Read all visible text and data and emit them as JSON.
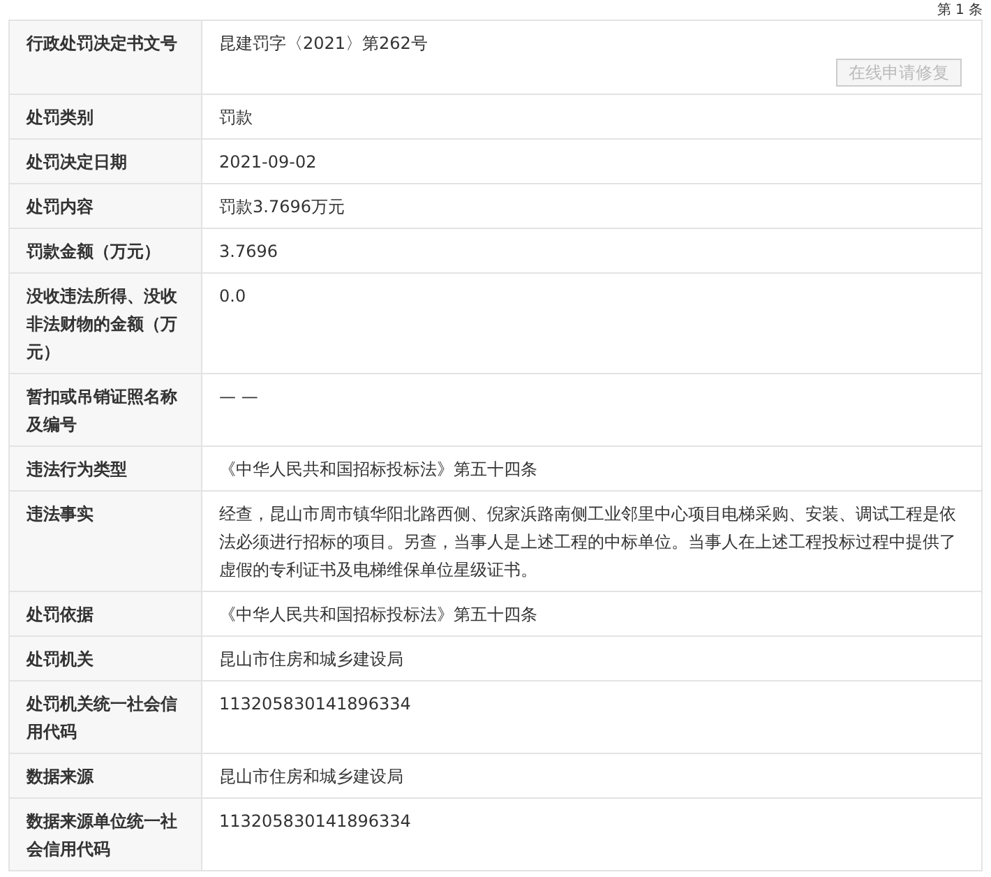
{
  "page_counter": "第 1 条",
  "rows": [
    {
      "label": "行政处罚决定书文号",
      "value": "昆建罚字〈2021〉第262号",
      "button": {
        "label": "在线申请修复",
        "disabled": true
      }
    },
    {
      "label": "处罚类别",
      "value": "罚款"
    },
    {
      "label": "处罚决定日期",
      "value": "2021-09-02"
    },
    {
      "label": "处罚内容",
      "value": "罚款3.7696万元"
    },
    {
      "label": "罚款金额（万元）",
      "value": "3.7696"
    },
    {
      "label": "没收违法所得、没收非法财物的金额（万元）",
      "value": "0.0"
    },
    {
      "label": "暂扣或吊销证照名称及编号",
      "value": "— —"
    },
    {
      "label": "违法行为类型",
      "value": "《中华人民共和国招标投标法》第五十四条"
    },
    {
      "label": "违法事实",
      "value": "经查，昆山市周市镇华阳北路西侧、倪家浜路南侧工业邻里中心项目电梯采购、安装、调试工程是依法必须进行招标的项目。另查，当事人是上述工程的中标单位。当事人在上述工程投标过程中提供了虚假的专利证书及电梯维保单位星级证书。"
    },
    {
      "label": "处罚依据",
      "value": "《中华人民共和国招标投标法》第五十四条"
    },
    {
      "label": "处罚机关",
      "value": "昆山市住房和城乡建设局"
    },
    {
      "label": "处罚机关统一社会信用代码",
      "value": "113205830141896334"
    },
    {
      "label": "数据来源",
      "value": "昆山市住房和城乡建设局"
    },
    {
      "label": "数据来源单位统一社会信用代码",
      "value": "113205830141896334"
    }
  ]
}
